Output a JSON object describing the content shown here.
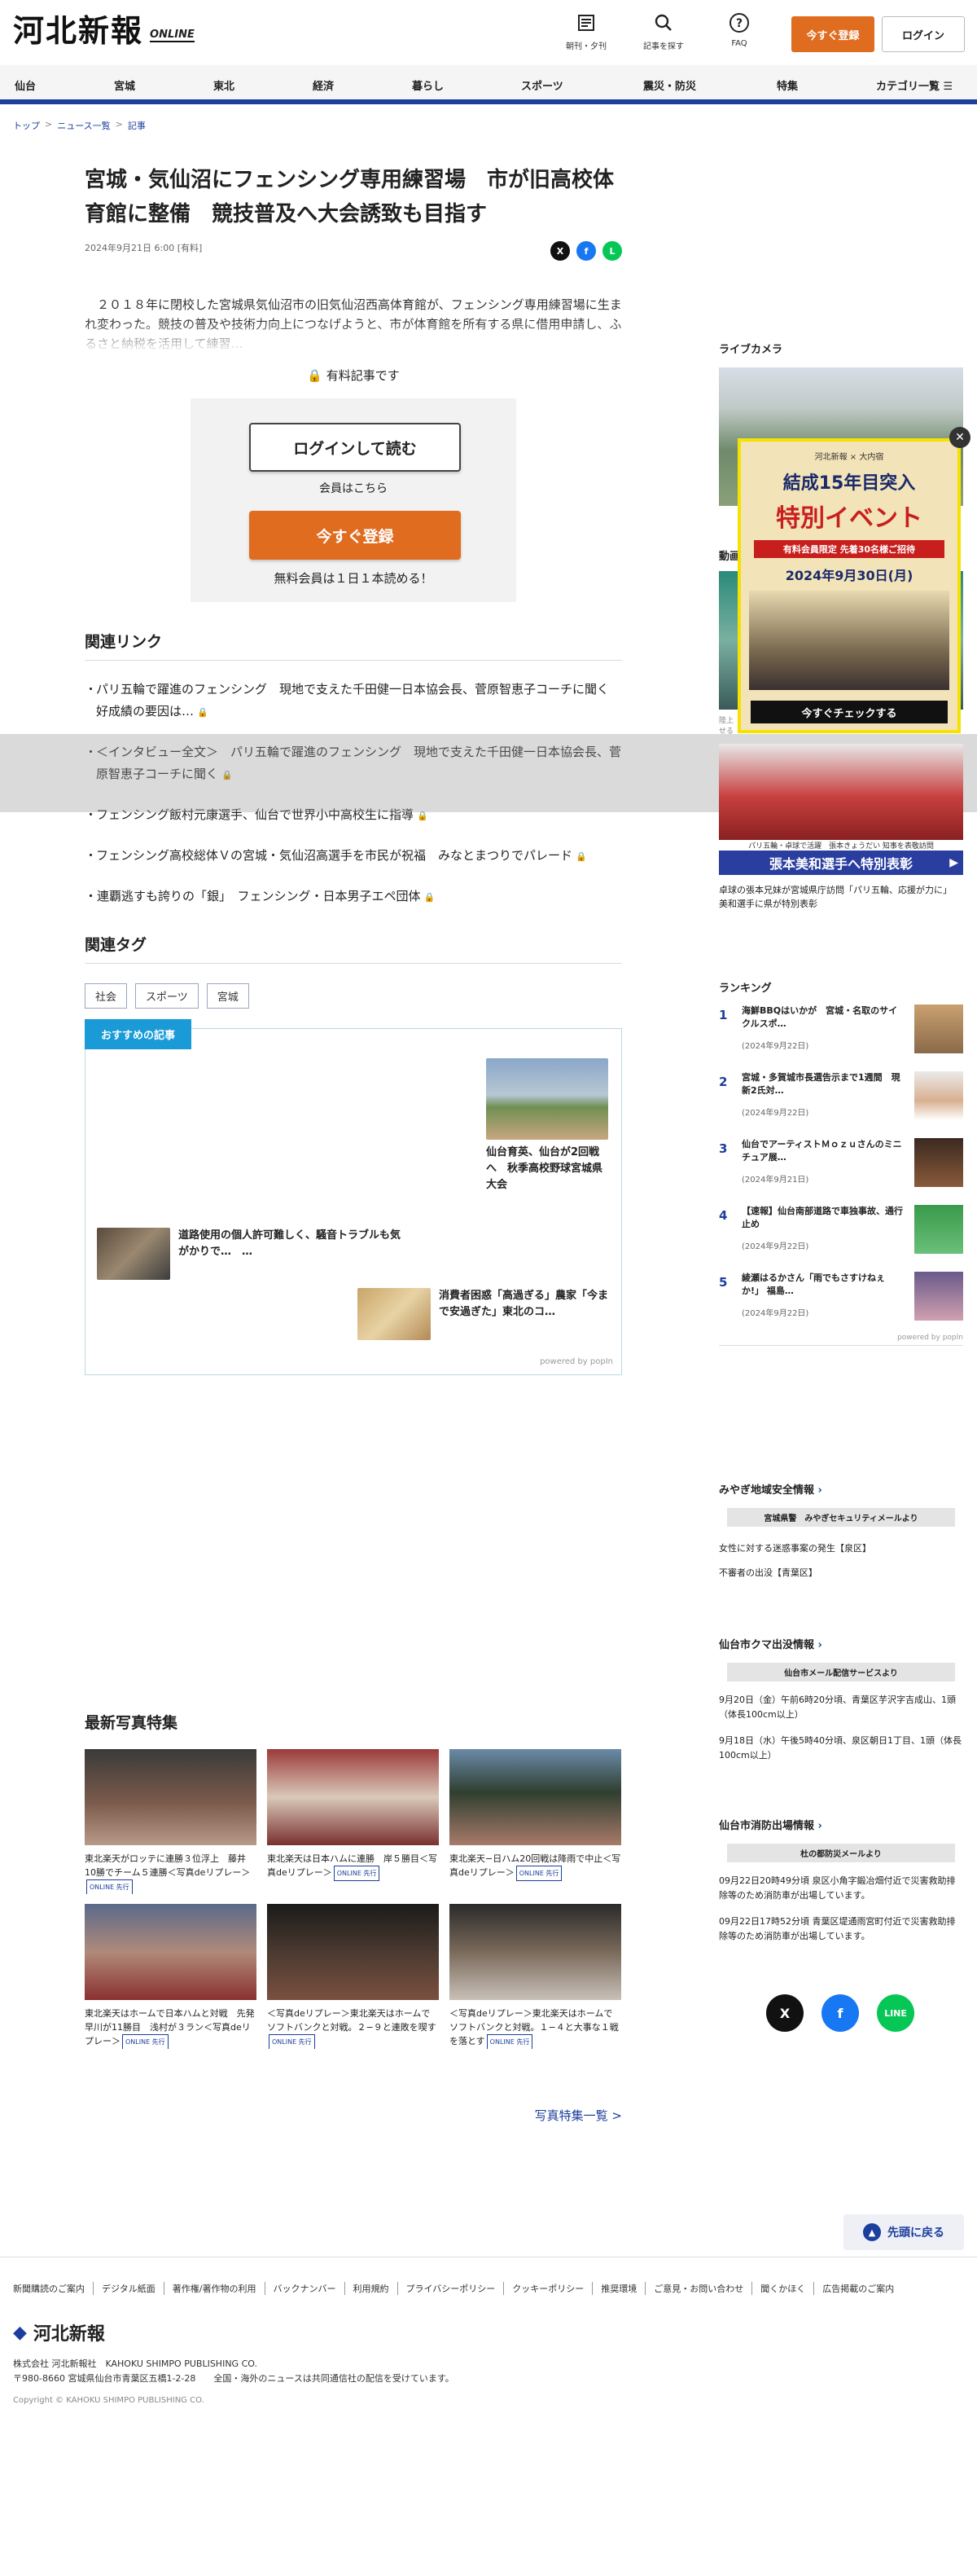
{
  "header": {
    "logo_main": "河北新報",
    "logo_sub": "ONLINE",
    "icons": [
      {
        "label": "朝刊・夕刊",
        "icon": "newspaper-icon"
      },
      {
        "label": "記事を探す",
        "icon": "search-icon"
      },
      {
        "label": "FAQ",
        "icon": "question-icon"
      }
    ],
    "register_label": "今すぐ登録",
    "login_label": "ログイン"
  },
  "nav": [
    "仙台",
    "宮城",
    "東北",
    "経済",
    "暮らし",
    "スポーツ",
    "震災・防災",
    "特集",
    "カテゴリ一覧"
  ],
  "breadcrumb": [
    "トップ",
    "ニュース一覧",
    "記事"
  ],
  "article": {
    "title": "宮城・気仙沼にフェンシング専用練習場　市が旧高校体育館に整備　競技普及へ大会誘致も目指す",
    "date": "2024年9月21日 6:00",
    "paid_tag": "[有料]",
    "lead": "　２０１８年に閉校した宮城県気仙沼市の旧気仙沼西高体育館が、フェンシング専用練習場に生まれ変わった。競技の普及や技術力向上につなげようと、市が体育館を所有する県に借用申請し、ふるさと納税を活用して練習…",
    "paid_label": "有料記事です",
    "login_btn": "ログインして読む",
    "member_text": "会員はこちら",
    "register_btn": "今すぐ登録",
    "free_text": "無料会員は１日１本読める！"
  },
  "related": {
    "heading": "関連リンク",
    "items": [
      "パリ五輪で躍進のフェンシング　現地で支えた千田健一日本協会長、菅原智恵子コーチに聞く　好成績の要因は…",
      "＜インタビュー全文＞　パリ五輪で躍進のフェンシング　現地で支えた千田健一日本協会長、菅原智恵子コーチに聞く",
      "フェンシング飯村元康選手、仙台で世界小中高校生に指導",
      "フェンシング高校総体Ｖの宮城・気仙沼高選手を市民が祝福　みなとまつりでパレード",
      "・連覇逃すも誇りの「銀」　フェンシング・日本男子エペ団体"
    ]
  },
  "tags": {
    "heading": "関連タグ",
    "items": [
      "社会",
      "スポーツ",
      "宮城"
    ]
  },
  "recommend": {
    "heading": "おすすめの記事",
    "items": [
      "仙台育英、仙台が2回戦へ　秋季高校野球宮城県大会",
      "道路使用の個人許可難しく、騒音トラブルも気がかりで…　…",
      "消費者困惑「高過ぎる」農家「今まで安過ぎた」東北のコ…"
    ],
    "powered": "powered by popIn"
  },
  "gallery": {
    "heading": "最新写真特集",
    "items": [
      "東北楽天がロッテに連勝３位浮上　藤井10勝でチーム５連勝＜写真deリプレー＞",
      "東北楽天は日本ハムに連勝　岸５勝目＜写真deリプレー＞",
      "東北楽天−日ハム20回戦は降雨で中止＜写真deリプレー＞",
      "東北楽天はホームで日本ハムと対戦　先発早川が11勝目　浅村が３ラン＜写真deリプレー＞",
      "＜写真deリプレー＞東北楽天はホームでソフトバンクと対戦。２−９と連敗を喫す",
      "＜写真deリプレー＞東北楽天はホームでソフトバンクと対戦。１−４と大事な１戦を落とす"
    ],
    "badge": "ONLINE 先行",
    "more": "写真特集一覧 >"
  },
  "sidebar": {
    "livecam": "ライブカメラ",
    "video": "動画",
    "video_caption": "パリ五輪・卓球で活躍　張本きょうだい 知事を表敬訪問",
    "video_banner": "張本美和選手へ特別表彰",
    "video_desc": "卓球の張本兄妹が宮城県庁訪問「パリ五輪、応援が力に」 美和選手に県が特別表彰",
    "overlay_caption": "陸上 ・ 高橋利基「被養者」なのか　歴史ある2人は 陸上 大会出場と思わせる",
    "ranking_heading": "ランキング",
    "ranking": [
      {
        "num": "1",
        "title": "海鮮BBQはいかが　宮城・名取のサイクルスポ…",
        "date": "(2024年9月22日)"
      },
      {
        "num": "2",
        "title": "宮城・多賀城市長選告示まで1週間　現新2氏対…",
        "date": "(2024年9月22日)"
      },
      {
        "num": "3",
        "title": "仙台でアーティストＭｏｚｕさんのミニチュア展…",
        "date": "(2024年9月21日)"
      },
      {
        "num": "4",
        "title": "【速報】仙台南部道路で車独事故、通行止め",
        "date": "(2024年9月22日)"
      },
      {
        "num": "5",
        "title": "綾瀬はるかさん「雨でもさすけねぇか!」 福島…",
        "date": "(2024年9月22日)"
      }
    ],
    "ranking_powered": "powered by popIn",
    "safety_heading": "みやぎ地域安全情報",
    "safety_source": "宮城県警　みやぎセキュリティメールより",
    "safety_items": [
      "女性に対する迷惑事案の発生【泉区】",
      "不審者の出没【青葉区】"
    ],
    "bear_heading": "仙台市クマ出没情報",
    "bear_source": "仙台市メール配信サービスより",
    "bear_items": [
      "9月20日（金）午前6時20分頃、青葉区芋沢字吉成山、1頭（体長100cm以上）",
      "9月18日（水）午後5時40分頃、泉区朝日1丁目、1頭（体長100cm以上）"
    ],
    "fire_heading": "仙台市消防出場情報",
    "fire_source": "杜の都防災メールより",
    "fire_items": [
      "09月22日20時49分頃 泉区小角字鍛冶畑付近で災害救助排除等のため消防車が出場しています。",
      "09月22日17時52分頃 青葉区堤通雨宮町付近で災害救助排除等のため消防車が出場しています。"
    ]
  },
  "ad": {
    "brand": "河北新報 × 大内宿",
    "headline1": "結成15年目突入",
    "headline2": "特別イベント",
    "sub": "有料会員限定 先着30名様ご招待",
    "deadline": "2024年9月30日(月)",
    "cta": "今すぐチェックする"
  },
  "totop": "先頭に戻る",
  "footer": {
    "links": [
      "新聞購読のご案内",
      "デジタル紙面",
      "著作権/著作物の利用",
      "バックナンバー",
      "利用規約",
      "プライバシーポリシー",
      "クッキーポリシー",
      "推奨環境",
      "ご意見・お問い合わせ",
      "聞くかほく",
      "広告掲載のご案内"
    ],
    "logo": "河北新報",
    "company": "株式会社 河北新報社　KAHOKU SHIMPO PUBLISHING CO.",
    "address": "〒980-8660 宮城県仙台市青葉区五橋1-2-28　　全国・海外のニュースは共同通信社の配信を受けています。",
    "copyright": "Copyright © KAHOKU SHIMPO PUBLISHING CO."
  },
  "colors": {
    "accent": "#1c3f9e",
    "orange": "#e06c20",
    "reco": "#1a9bd8"
  }
}
